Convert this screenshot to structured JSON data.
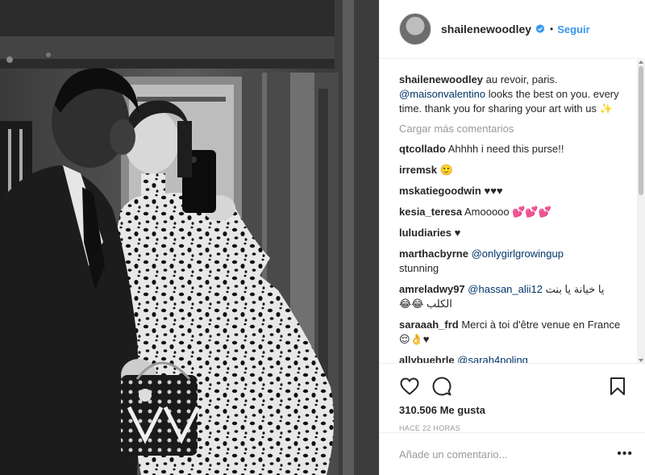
{
  "post": {
    "username": "shailenewoodley",
    "follow_label": "Seguir",
    "separator": "•",
    "caption": {
      "username": "shailenewoodley",
      "text_before": " au revoir, paris. ",
      "mention": "@maisonvalentino",
      "text_after": " looks the best on you. every time. thank you for sharing your art with us ✨"
    },
    "load_more_label": "Cargar más comentarios",
    "comments": [
      {
        "username": "qtcollado",
        "text": "Ahhhh i need this purse!!"
      },
      {
        "username": "irremsk",
        "text": "🙂"
      },
      {
        "username": "mskatiegoodwin",
        "text": "♥♥♥"
      },
      {
        "username": "kesia_teresa",
        "text": "Amooooo 💕💕💕"
      },
      {
        "username": "luludiaries",
        "text": "♥"
      },
      {
        "username": "marthacbyrne",
        "mention": "@onlygirlgrowingup",
        "text": "stunning"
      },
      {
        "username": "amreladwy97",
        "mention": "@hassan_alii12",
        "text": "يا خيانة يا بنت الكلب 😂😂"
      },
      {
        "username": "saraaah_frd",
        "text": "Merci à toi d'être venue en France😌👌♥"
      },
      {
        "username": "allybuehrle",
        "mention": "@sarah4poling",
        "text": ""
      }
    ],
    "likes": "310.506 Me gusta",
    "time": "HACE 22 HORAS",
    "add_comment_placeholder": "Añade un comentario...",
    "more_label": "•••"
  },
  "icons": {
    "like": "heart-icon",
    "comment": "comment-icon",
    "save": "bookmark-icon",
    "verified": "verified-badge-icon"
  },
  "colors": {
    "link": "#3897f0",
    "mention": "#003569",
    "muted": "#999999",
    "text": "#262626",
    "border": "#efefef"
  }
}
